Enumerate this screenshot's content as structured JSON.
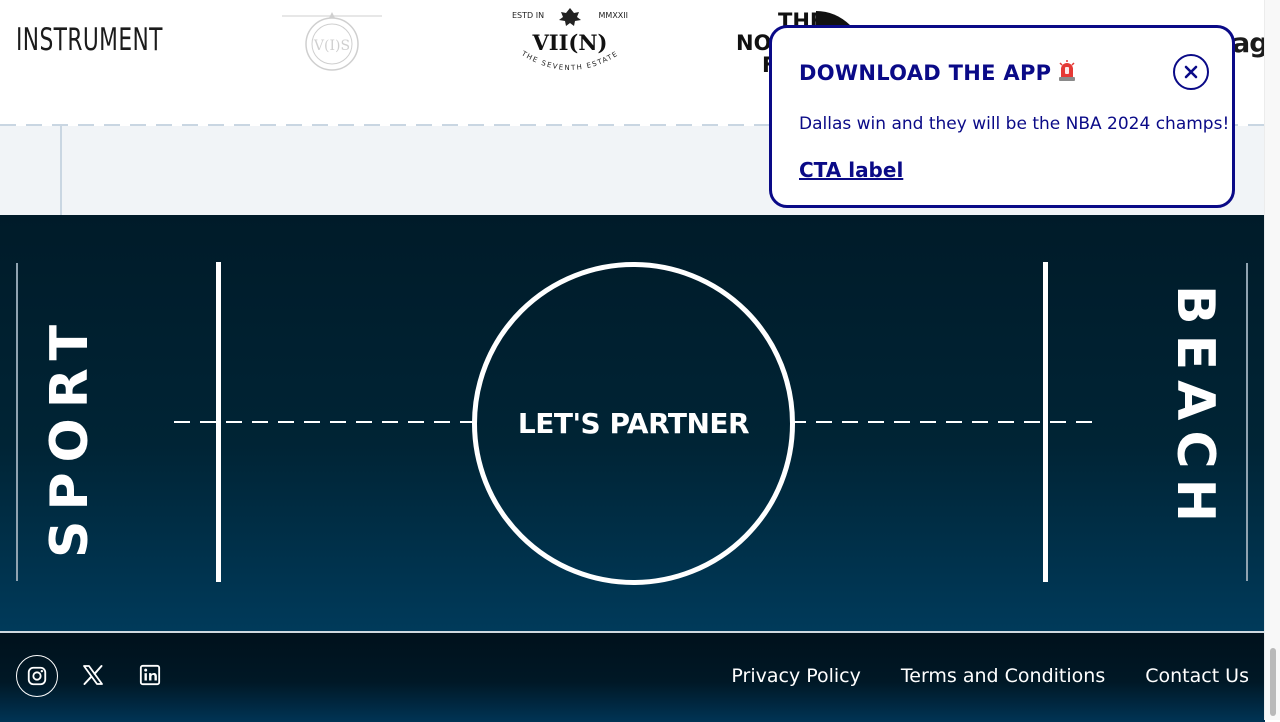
{
  "logos": {
    "instrument": "INSTRUMENT",
    "viin_top_left": "ESTD IN",
    "viin_top_right": "MMXXII",
    "viin_main": "VII(N)",
    "viin_sub": "THE SEVENTH ESTATE",
    "northface_line1": "THE",
    "northface_line2": "NO",
    "northface_line3": "F",
    "edge_partial": "ag"
  },
  "popup": {
    "title": "DOWNLOAD THE APP",
    "title_icon": "siren-emoji",
    "body": "Dallas win and they will be the NBA 2024 champs!",
    "cta_label": "CTA label",
    "close_icon": "close-icon",
    "accent_color": "#0a0a87"
  },
  "court": {
    "left_word": "SPORT",
    "right_word": "BEACH",
    "center_label": "LET'S PARTNER"
  },
  "footer": {
    "social": [
      {
        "name": "instagram",
        "icon": "instagram-icon"
      },
      {
        "name": "x",
        "icon": "x-icon"
      },
      {
        "name": "linkedin",
        "icon": "linkedin-icon"
      }
    ],
    "links": [
      "Privacy Policy",
      "Terms and Conditions",
      "Contact Us"
    ]
  }
}
